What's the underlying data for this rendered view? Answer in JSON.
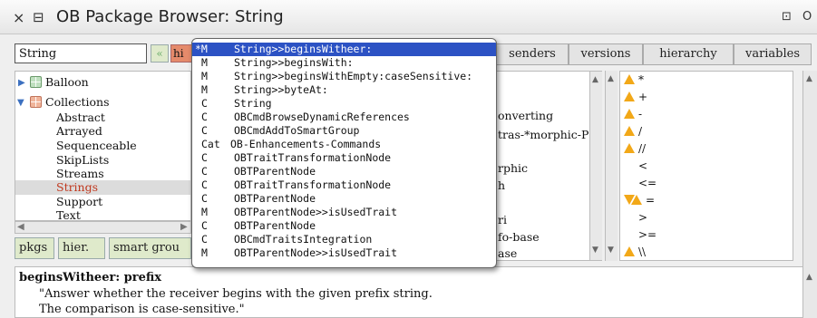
{
  "window": {
    "title": "OB Package Browser: String",
    "close_glyph": "×",
    "menu_glyph": "⊟",
    "right_glyphs": "⊡ O"
  },
  "search": {
    "value": "String",
    "prev_label": "«",
    "hist_label": "hi"
  },
  "tabs": [
    "senders",
    "versions",
    "hierarchy",
    "variables"
  ],
  "packages": {
    "balloon": "Balloon",
    "collections": "Collections",
    "items": [
      "Abstract",
      "Arrayed",
      "Sequenceable",
      "SkipLists",
      "Streams",
      "Strings",
      "Support",
      "Text"
    ],
    "selected": "Strings"
  },
  "pane_buttons": [
    "pkgs",
    "hier.",
    "smart grou"
  ],
  "middle_fragments": [
    "onverting",
    "tras-*morphic-P",
    "rphic",
    "h",
    "ri",
    "fo-base",
    "ase"
  ],
  "methods": [
    {
      "mark": "warn",
      "sym": "*"
    },
    {
      "mark": "warn",
      "sym": "+"
    },
    {
      "mark": "warn",
      "sym": "-"
    },
    {
      "mark": "warn",
      "sym": "/"
    },
    {
      "mark": "warn",
      "sym": "//"
    },
    {
      "mark": "none",
      "sym": "<"
    },
    {
      "mark": "none",
      "sym": "<="
    },
    {
      "mark": "both",
      "sym": "="
    },
    {
      "mark": "none",
      "sym": ">"
    },
    {
      "mark": "none",
      "sym": ">="
    },
    {
      "mark": "warn",
      "sym": "\\\\"
    }
  ],
  "suggestions": [
    {
      "kind": "*M",
      "name": "String>>beginsWitheer:",
      "selected": true
    },
    {
      "kind": "M",
      "name": "String>>beginsWith:"
    },
    {
      "kind": "M",
      "name": "String>>beginsWithEmpty:caseSensitive:"
    },
    {
      "kind": "M",
      "name": "String>>byteAt:"
    },
    {
      "kind": "C",
      "name": "String"
    },
    {
      "kind": "C",
      "name": "OBCmdBrowseDynamicReferences"
    },
    {
      "kind": "C",
      "name": "OBCmdAddToSmartGroup"
    },
    {
      "kind": "Cat",
      "name": "OB-Enhancements-Commands"
    },
    {
      "kind": "C",
      "name": "OBTraitTransformationNode"
    },
    {
      "kind": "C",
      "name": "OBTParentNode"
    },
    {
      "kind": "C",
      "name": "OBTraitTransformationNode"
    },
    {
      "kind": "C",
      "name": "OBTParentNode"
    },
    {
      "kind": "M",
      "name": "OBTParentNode>>isUsedTrait"
    },
    {
      "kind": "C",
      "name": "OBTParentNode"
    },
    {
      "kind": "C",
      "name": "OBCmdTraitsIntegration"
    },
    {
      "kind": "M",
      "name": "OBTParentNode>>isUsedTrait"
    }
  ],
  "code": {
    "signature": "beginsWitheer: prefix",
    "comment_line1": "\"Answer whether the receiver begins with the given prefix string.",
    "comment_line2": "The comparison is case-sensitive.\""
  },
  "colors": {
    "selection": "#2c52c4",
    "selected_package_text": "#c0391f",
    "warning": "#f2a818",
    "button_green": "#dfeacb",
    "history_button": "#e58a6b"
  }
}
